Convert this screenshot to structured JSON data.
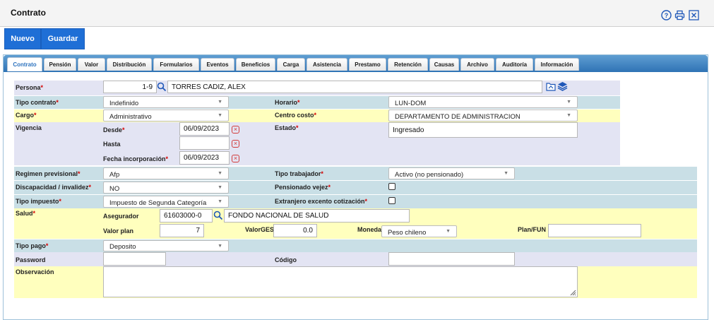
{
  "header": {
    "title": "Contrato"
  },
  "toolbar": {
    "new_label": "Nuevo",
    "save_label": "Guardar"
  },
  "tabs": [
    "Contrato",
    "Pensión",
    "Valor",
    "Distribución",
    "Formularios",
    "Eventos",
    "Beneficios",
    "Carga",
    "Asistencia",
    "Prestamo",
    "Retención",
    "Causas",
    "Archivo",
    "Auditoría",
    "Información"
  ],
  "active_tab": "Contrato",
  "form": {
    "persona": {
      "label": "Persona",
      "rut": "1-9",
      "name": "TORRES CADIZ, ALEX"
    },
    "tipo_contrato": {
      "label": "Tipo contrato",
      "value": "Indefinido"
    },
    "horario": {
      "label": "Horario",
      "value": "LUN-DOM"
    },
    "cargo": {
      "label": "Cargo",
      "value": "Administrativo"
    },
    "centro_costo": {
      "label": "Centro costo",
      "value": "DEPARTAMENTO DE ADMINISTRACION"
    },
    "vigencia": {
      "label": "Vigencia",
      "desde_label": "Desde",
      "desde": "06/09/2023",
      "hasta_label": "Hasta",
      "hasta": "",
      "incorporacion_label": "Fecha incorporación",
      "incorporacion": "06/09/2023"
    },
    "estado": {
      "label": "Estado",
      "value": "Ingresado"
    },
    "regimen": {
      "label": "Regimen previsional",
      "value": "Afp"
    },
    "tipo_trabajador": {
      "label": "Tipo trabajador",
      "value": "Activo (no pensionado)"
    },
    "discapacidad": {
      "label": "Discapacidad / invalidez",
      "value": "NO"
    },
    "pensionado_vejez": {
      "label": "Pensionado vejez",
      "checked": false
    },
    "tipo_impuesto": {
      "label": "Tipo impuesto",
      "value": "Impuesto de Segunda Categoría"
    },
    "extranjero": {
      "label": "Extranjero excento cotización",
      "checked": false
    },
    "salud": {
      "label": "Salud",
      "asegurador_label": "Asegurador",
      "asegurador_code": "61603000-0",
      "asegurador_name": "FONDO NACIONAL DE SALUD",
      "valor_plan_label": "Valor plan",
      "valor_plan": "7",
      "valor_ges_label": "ValorGES",
      "valor_ges": "0.0",
      "moneda_label": "Moneda",
      "moneda": "Peso chileno",
      "plan_fun_label": "Plan/FUN",
      "plan_fun": ""
    },
    "tipo_pago": {
      "label": "Tipo pago",
      "value": "Deposito"
    },
    "password": {
      "label": "Password",
      "value": ""
    },
    "codigo": {
      "label": "Código",
      "value": ""
    },
    "observacion": {
      "label": "Observación",
      "value": ""
    }
  }
}
